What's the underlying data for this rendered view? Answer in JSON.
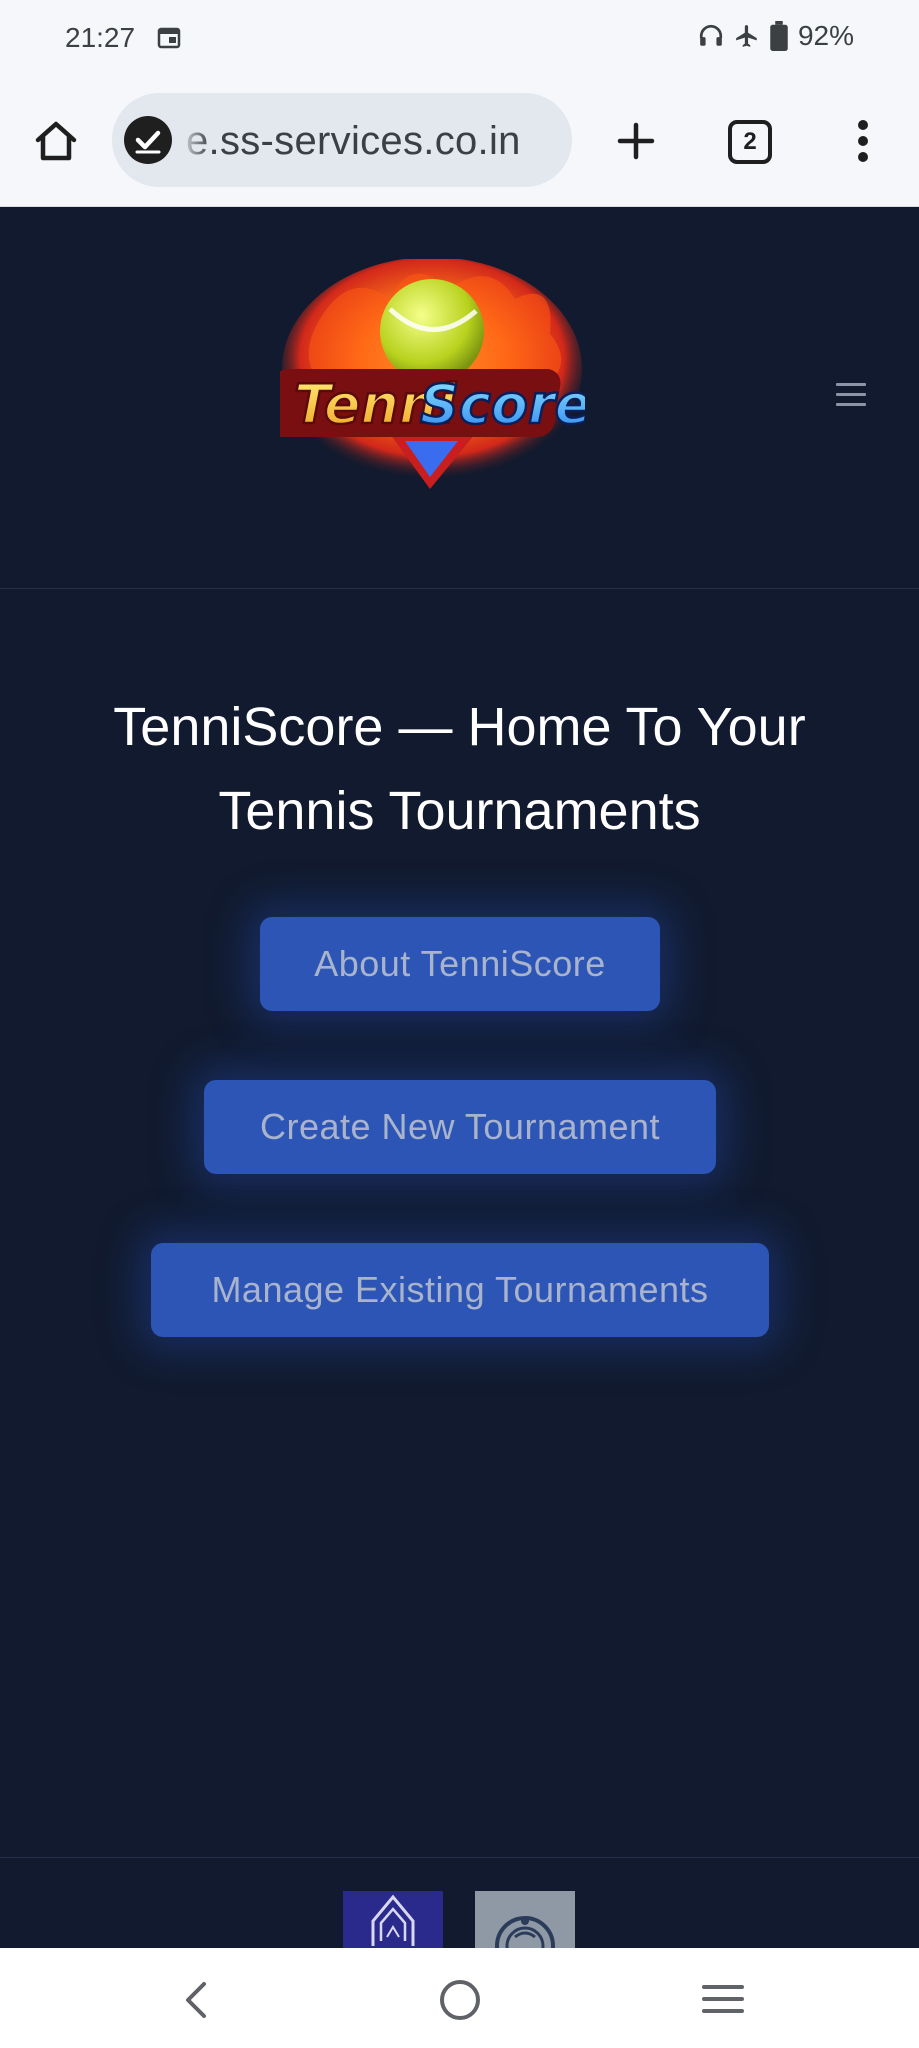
{
  "status_bar": {
    "time": "21:27",
    "battery": "92%",
    "icons": [
      "calendar-icon",
      "headphones-icon",
      "airplane-icon",
      "battery-icon"
    ]
  },
  "browser": {
    "url": "e.ss-services.co.in",
    "tab_count": "2",
    "icons": [
      "home-icon",
      "site-verified-icon",
      "new-tab-icon",
      "tabs-icon",
      "overflow-menu-icon"
    ]
  },
  "header": {
    "logo_text_part1": "Tenni",
    "logo_text_part2": "Score",
    "menu_icon": "hamburger-icon"
  },
  "hero": {
    "title": "TenniScore — Home To Your Tennis Tournaments"
  },
  "actions": {
    "about": "About TenniScore",
    "create": "Create New Tournament",
    "manage": "Manage Existing Tournaments"
  },
  "nav_bar": {
    "icons": [
      "back-icon",
      "home-icon",
      "recents-icon"
    ]
  },
  "colors": {
    "page_bg": "#111a2e",
    "button_bg": "#2c55b6",
    "button_text": "#a9b4cc",
    "title_text": "#ffffff"
  }
}
